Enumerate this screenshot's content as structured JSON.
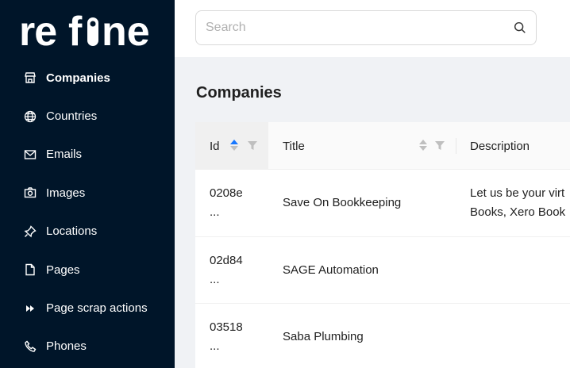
{
  "sidebar": {
    "logo_text": "refine",
    "items": [
      {
        "label": "Companies",
        "icon": "store-icon",
        "active": true
      },
      {
        "label": "Countries",
        "icon": "globe-icon",
        "active": false
      },
      {
        "label": "Emails",
        "icon": "mail-icon",
        "active": false
      },
      {
        "label": "Images",
        "icon": "camera-icon",
        "active": false
      },
      {
        "label": "Locations",
        "icon": "pin-icon",
        "active": false
      },
      {
        "label": "Pages",
        "icon": "file-icon",
        "active": false
      },
      {
        "label": "Page scrap actions",
        "icon": "fast-forward-icon",
        "active": false
      },
      {
        "label": "Phones",
        "icon": "phone-icon",
        "active": false
      }
    ]
  },
  "header": {
    "search": {
      "placeholder": "Search",
      "value": "",
      "icon": "search-icon"
    }
  },
  "main": {
    "title": "Companies",
    "table": {
      "columns": [
        {
          "label": "Id",
          "sort": "ascending",
          "filter": true
        },
        {
          "label": "Title",
          "sort": "none",
          "filter": true
        },
        {
          "label": "Description",
          "sort": "none",
          "filter": false
        }
      ],
      "rows": [
        {
          "id_line1": "0208e",
          "id_line2": "...",
          "title": "Save On Bookkeeping",
          "desc_line1": "Let us be your virt",
          "desc_line2": "Books, Xero Book"
        },
        {
          "id_line1": "02d84",
          "id_line2": "...",
          "title": "SAGE Automation",
          "desc_line1": "",
          "desc_line2": ""
        },
        {
          "id_line1": "03518",
          "id_line2": "...",
          "title": "Saba Plumbing",
          "desc_line1": "",
          "desc_line2": ""
        }
      ]
    }
  },
  "colors": {
    "sidebar_bg": "#001529",
    "sort_active": "#1677ff",
    "page_bg": "#f0f2f5"
  }
}
